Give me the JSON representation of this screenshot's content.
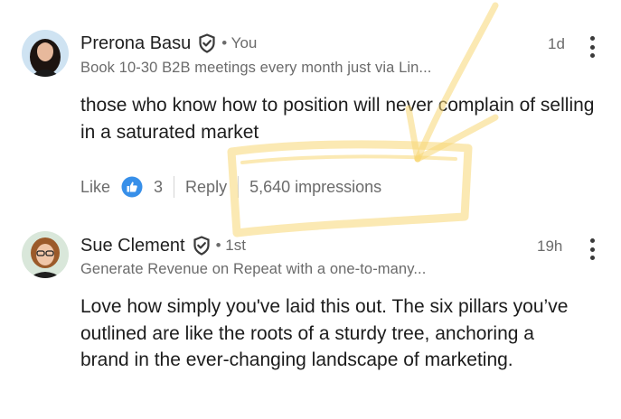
{
  "comments": [
    {
      "name": "Prerona Basu",
      "connection": "• You",
      "headline": "Book 10-30 B2B meetings every month just via Lin...",
      "time": "1d",
      "body": "those who know how to position will never complain of selling in a saturated market",
      "actions": {
        "like_label": "Like",
        "like_count": "3",
        "reply_label": "Reply",
        "impressions": "5,640 impressions"
      }
    },
    {
      "name": "Sue Clement",
      "connection": "• 1st",
      "headline": "Generate Revenue on Repeat with a one-to-many...",
      "time": "19h",
      "body": "Love how simply you've laid this out. The six pillars you’ve outlined are like the roots of a sturdy tree, anchoring a brand in the ever-changing landscape of marketing."
    }
  ],
  "colors": {
    "like_blue": "#378fe9",
    "highlight": "#f7d774",
    "text_muted": "#6b6b6b"
  },
  "icons": [
    "verified-badge-icon",
    "like-reaction-icon",
    "more-options-icon"
  ]
}
